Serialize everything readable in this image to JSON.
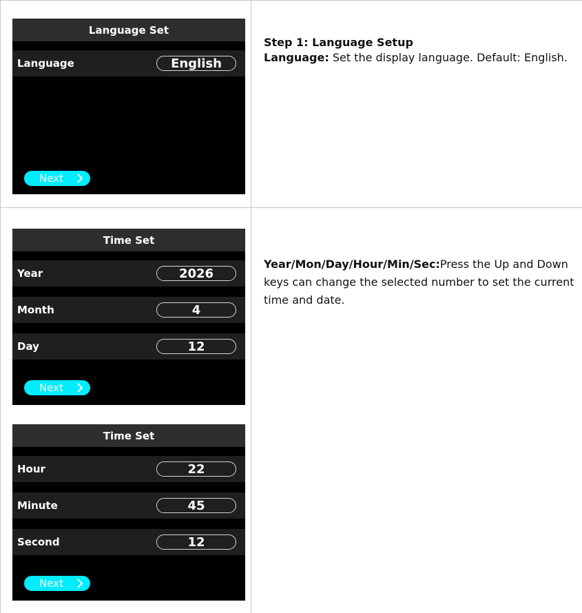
{
  "steps": [
    {
      "screen": {
        "title": "Language Set",
        "rows": [
          {
            "label": "Language",
            "value": "English"
          }
        ],
        "next_label": "Next",
        "next_icon": "chevron-right-icon"
      },
      "description": {
        "heading": "Step 1: Language Setup",
        "term": "Language:",
        "text": " Set the display language. Default: English."
      }
    },
    {
      "screens": [
        {
          "title": "Time Set",
          "rows": [
            {
              "label": "Year",
              "value": "2026"
            },
            {
              "label": "Month",
              "value": "4"
            },
            {
              "label": "Day",
              "value": "12"
            }
          ],
          "next_label": "Next",
          "next_icon": "chevron-right-icon"
        },
        {
          "title": "Time Set",
          "rows": [
            {
              "label": "Hour",
              "value": "22"
            },
            {
              "label": "Minute",
              "value": "45"
            },
            {
              "label": "Second",
              "value": "12"
            }
          ],
          "next_label": "Next",
          "next_icon": "chevron-right-icon"
        }
      ],
      "description": {
        "term": "Year/Mon/Day/Hour/Min/Sec:",
        "text": "Press the Up and Down keys can change the selected number to set the current time and date."
      }
    }
  ],
  "colors": {
    "screen_bg": "#000000",
    "title_bar": "#2e2e2e",
    "row_bg": "#1f1f1f",
    "accent_button": "#00ecff",
    "grid_line": "#c8c8c8"
  }
}
